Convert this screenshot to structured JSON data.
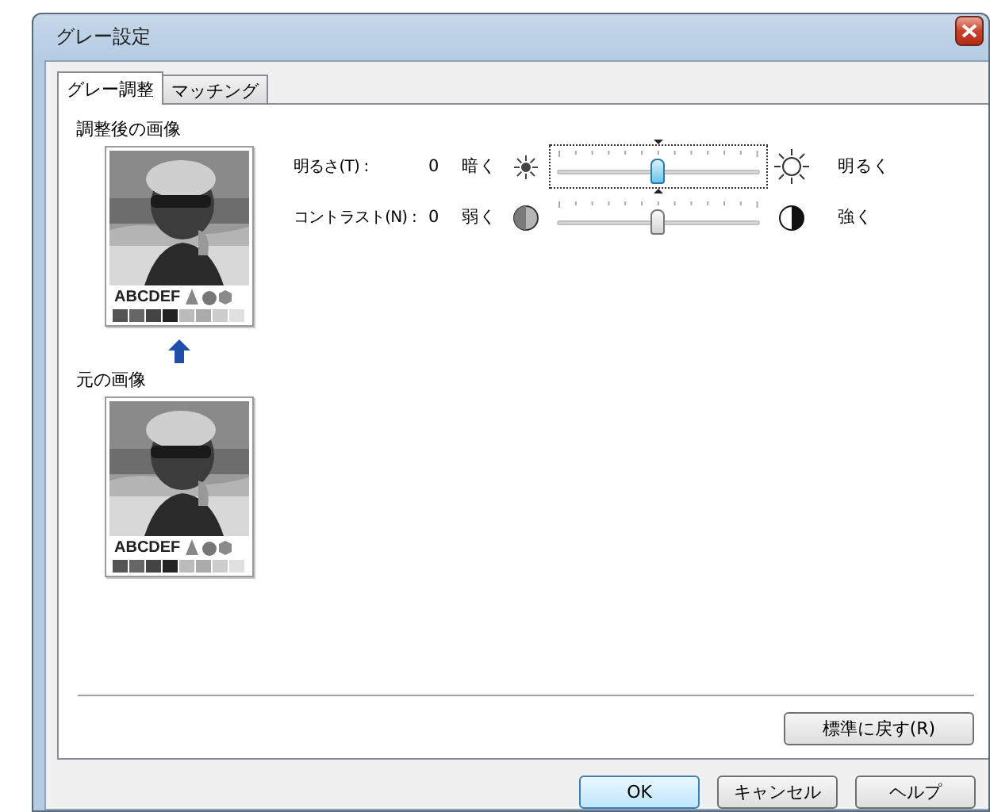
{
  "window": {
    "title": "グレー設定"
  },
  "tabs": [
    {
      "label": "グレー調整",
      "selected": true
    },
    {
      "label": "マッチング",
      "selected": false
    }
  ],
  "preview": {
    "adjusted_label": "調整後の画像",
    "adjusted_sample_text": "ABCDEF",
    "original_label": "元の画像",
    "original_sample_text": "ABCDEF"
  },
  "sliders": [
    {
      "kind": "brightness",
      "label": "明るさ(T) :",
      "value": "0",
      "low_label": "暗く",
      "high_label": "明るく",
      "level": 0.5,
      "focused": true
    },
    {
      "kind": "contrast",
      "label": "コントラスト(N) :",
      "value": "0",
      "low_label": "弱く",
      "high_label": "強く",
      "level": 0.5,
      "focused": false
    }
  ],
  "reset_button": "標準に戻す(R)",
  "buttons": [
    {
      "label": "OK",
      "default": true
    },
    {
      "label": "キャンセル",
      "default": false
    },
    {
      "label": "ヘルプ",
      "default": false
    }
  ]
}
